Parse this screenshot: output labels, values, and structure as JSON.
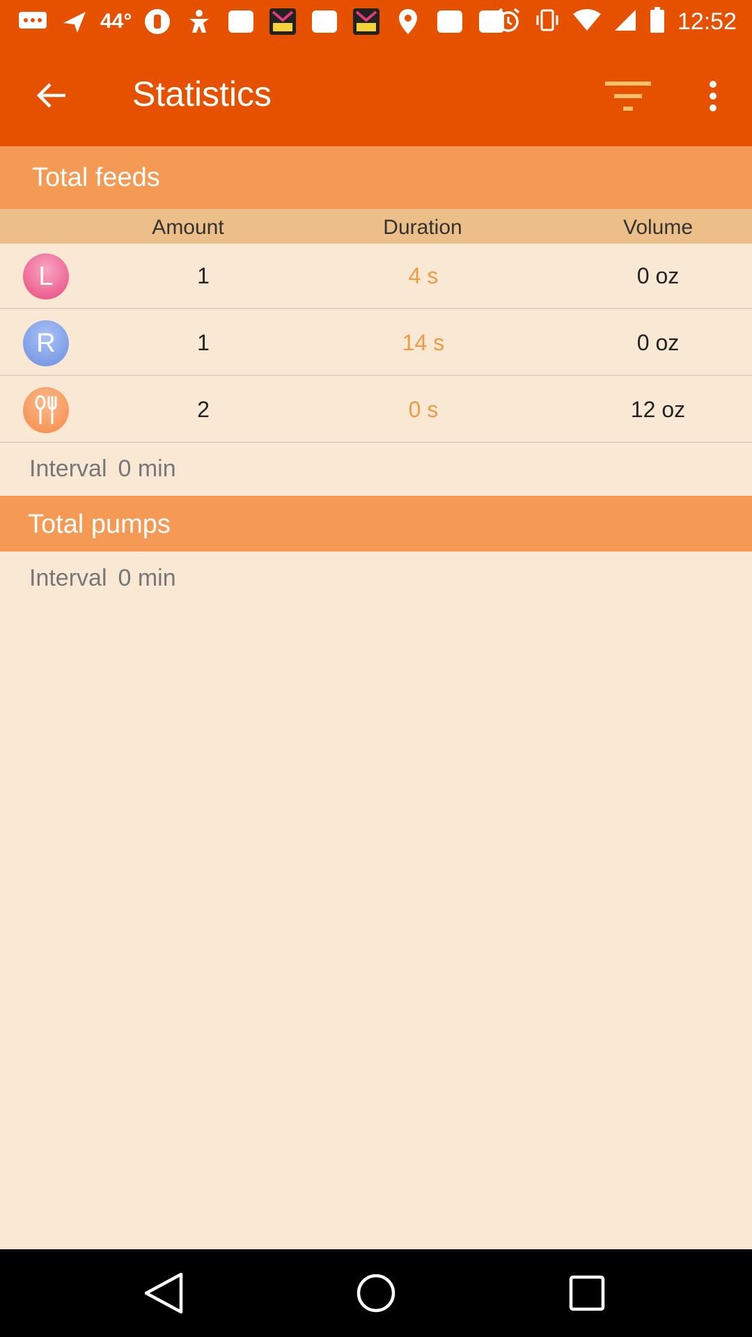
{
  "status_bar": {
    "temperature": "44°",
    "time": "12:52",
    "left_icons": [
      "message-icon",
      "navigation-icon",
      "temperature-text",
      "baby-bottle-icon",
      "figure-icon",
      "square-icon",
      "pop-app-icon",
      "square-icon",
      "pop-app-icon",
      "location-pin-icon",
      "square-icon",
      "square-icon"
    ],
    "right_icons": [
      "alarm-icon",
      "vibrate-icon",
      "wifi-icon",
      "cell-signal-icon",
      "battery-icon"
    ]
  },
  "app_bar": {
    "title": "Statistics"
  },
  "total_feeds": {
    "title": "Total feeds",
    "columns": [
      "Amount",
      "Duration",
      "Volume"
    ],
    "rows": [
      {
        "icon_label": "L",
        "icon_name": "left-breast-icon",
        "color": "#e9487c",
        "amount": "1",
        "duration": "4 s",
        "volume": "0 oz"
      },
      {
        "icon_label": "R",
        "icon_name": "right-breast-icon",
        "color": "#6c8fe0",
        "amount": "1",
        "duration": "14 s",
        "volume": "0 oz"
      },
      {
        "icon_label": "",
        "icon_name": "bottle-feed-icon",
        "color": "#f58a4a",
        "amount": "2",
        "duration": "0 s",
        "volume": "12 oz"
      }
    ],
    "interval_label": "Interval",
    "interval_value": "0 min"
  },
  "total_pumps": {
    "title": "Total pumps",
    "interval_label": "Interval",
    "interval_value": "0 min"
  },
  "colors": {
    "primary": "#e65100",
    "section_header": "#f59a54",
    "column_header": "#edbf88",
    "background": "#f8e8d4",
    "duration_text": "#f09a46"
  }
}
